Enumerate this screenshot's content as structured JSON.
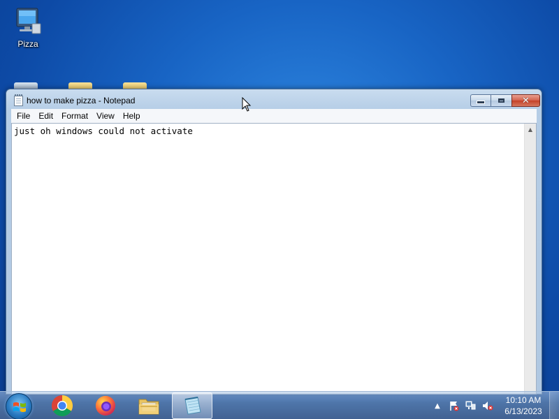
{
  "desktop": {
    "icons": [
      {
        "label": "Pizza",
        "icon": "computer-icon"
      }
    ]
  },
  "window": {
    "title": "how to make pizza - Notepad",
    "icon": "notepad-icon",
    "buttons": {
      "minimize": "minimize-icon",
      "maximize": "maximize-icon",
      "close": "close-icon"
    },
    "menu": [
      "File",
      "Edit",
      "Format",
      "View",
      "Help"
    ],
    "content": "just oh windows could not activate"
  },
  "taskbar": {
    "apps": [
      {
        "name": "Google Chrome",
        "icon": "chrome-icon",
        "active": false
      },
      {
        "name": "Firefox",
        "icon": "firefox-icon",
        "active": false
      },
      {
        "name": "Windows Explorer",
        "icon": "folder-icon",
        "active": false
      },
      {
        "name": "Notepad",
        "icon": "notepad-icon",
        "active": true
      }
    ],
    "tray": [
      "show-hidden-icons-icon",
      "action-center-flag-icon",
      "network-icon",
      "volume-muted-icon"
    ],
    "clock": {
      "time": "10:10 AM",
      "date": "6/13/2023"
    }
  },
  "colors": {
    "desktop": "#1864c4",
    "titlebar": "#c9dcef",
    "close_button": "#c44128"
  }
}
